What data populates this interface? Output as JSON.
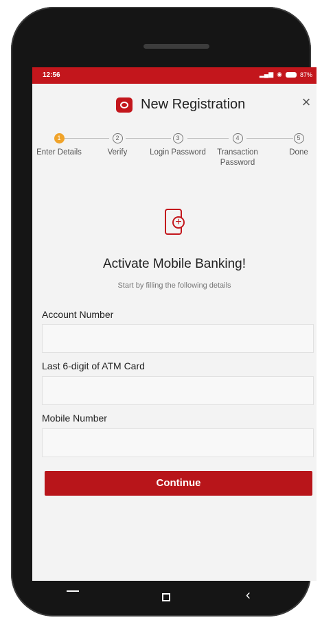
{
  "status_bar": {
    "time": "12:56",
    "battery": "87%"
  },
  "header": {
    "title": "New Registration"
  },
  "steps": [
    {
      "num": "1",
      "label": "Enter Details"
    },
    {
      "num": "2",
      "label": "Verify"
    },
    {
      "num": "3",
      "label": "Login Password"
    },
    {
      "num": "4",
      "label": "Transaction Password"
    },
    {
      "num": "5",
      "label": "Done"
    }
  ],
  "hero": {
    "heading": "Activate Mobile Banking!",
    "subheading": "Start by filling the following details"
  },
  "form": {
    "account_label": "Account Number",
    "atm_label": "Last 6-digit of ATM Card",
    "mobile_label": "Mobile Number",
    "continue_label": "Continue"
  },
  "colors": {
    "brand_red": "#c3161c",
    "active_step": "#f0a32a"
  }
}
